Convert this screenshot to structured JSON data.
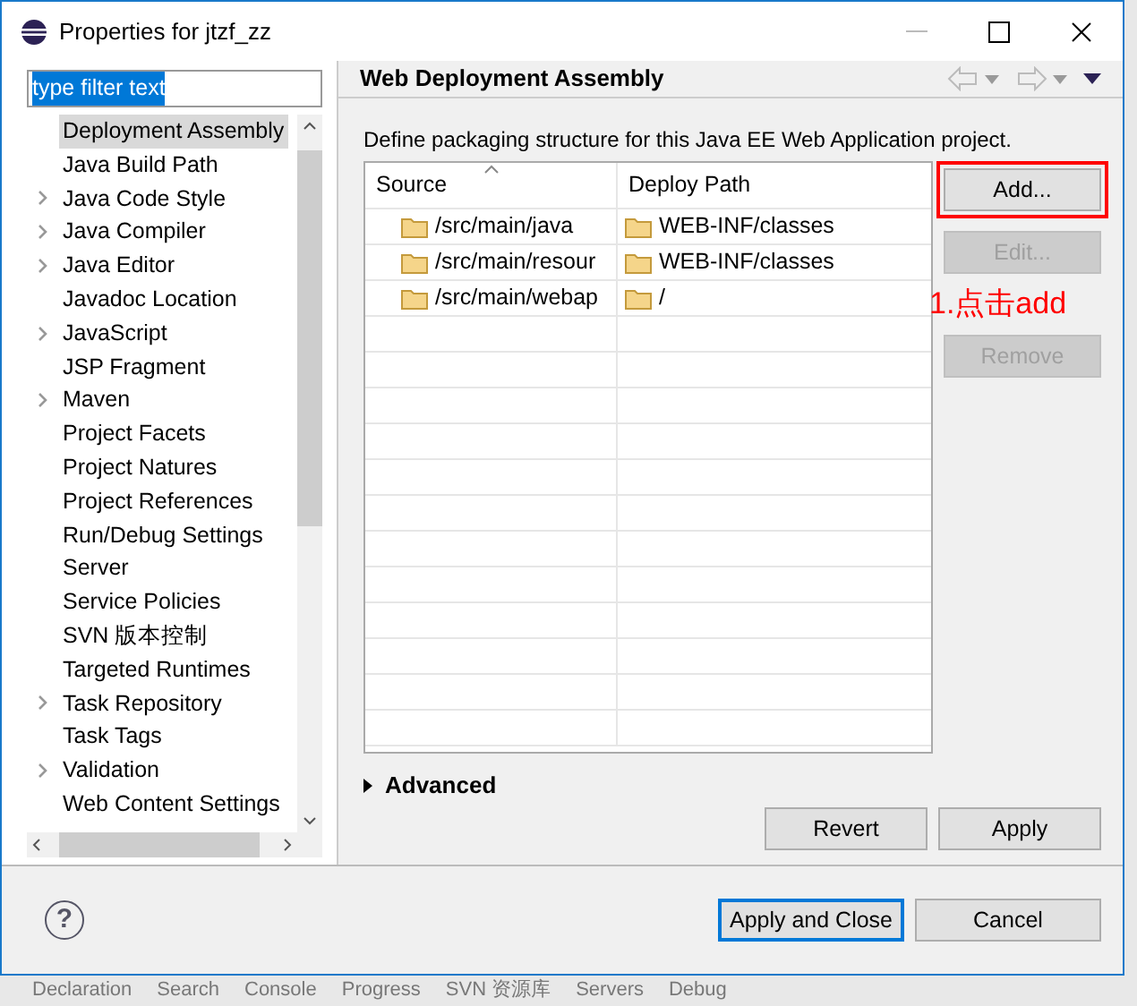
{
  "window": {
    "title": "Properties for jtzf_zz"
  },
  "filter": {
    "value": "type filter text",
    "selected": true
  },
  "tree": {
    "items": [
      {
        "label": "Deployment Assembly",
        "expandable": false,
        "selected": true
      },
      {
        "label": "Java Build Path",
        "expandable": false,
        "selected": false
      },
      {
        "label": "Java Code Style",
        "expandable": true,
        "selected": false
      },
      {
        "label": "Java Compiler",
        "expandable": true,
        "selected": false
      },
      {
        "label": "Java Editor",
        "expandable": true,
        "selected": false
      },
      {
        "label": "Javadoc Location",
        "expandable": false,
        "selected": false
      },
      {
        "label": "JavaScript",
        "expandable": true,
        "selected": false
      },
      {
        "label": "JSP Fragment",
        "expandable": false,
        "selected": false
      },
      {
        "label": "Maven",
        "expandable": true,
        "selected": false
      },
      {
        "label": "Project Facets",
        "expandable": false,
        "selected": false
      },
      {
        "label": "Project Natures",
        "expandable": false,
        "selected": false
      },
      {
        "label": "Project References",
        "expandable": false,
        "selected": false
      },
      {
        "label": "Run/Debug Settings",
        "expandable": false,
        "selected": false
      },
      {
        "label": "Server",
        "expandable": false,
        "selected": false
      },
      {
        "label": "Service Policies",
        "expandable": false,
        "selected": false
      },
      {
        "label": "SVN 版本控制",
        "expandable": false,
        "selected": false
      },
      {
        "label": "Targeted Runtimes",
        "expandable": false,
        "selected": false
      },
      {
        "label": "Task Repository",
        "expandable": true,
        "selected": false
      },
      {
        "label": "Task Tags",
        "expandable": false,
        "selected": false
      },
      {
        "label": "Validation",
        "expandable": true,
        "selected": false
      },
      {
        "label": "Web Content Settings",
        "expandable": false,
        "selected": false
      }
    ]
  },
  "page": {
    "title": "Web Deployment Assembly",
    "description": "Define packaging structure for this Java EE Web Application project.",
    "table": {
      "columns": [
        "Source",
        "Deploy Path"
      ],
      "rows": [
        {
          "source": "/src/main/java",
          "deploy_path": "WEB-INF/classes"
        },
        {
          "source": "/src/main/resour",
          "deploy_path": "WEB-INF/classes"
        },
        {
          "source": "/src/main/webap",
          "deploy_path": "/"
        }
      ]
    },
    "side_buttons": [
      {
        "label": "Add...",
        "disabled": false,
        "highlighted": true
      },
      {
        "label": "Edit...",
        "disabled": true,
        "highlighted": false
      },
      {
        "label": "Remove",
        "disabled": true,
        "highlighted": false
      }
    ],
    "annotation": "1.点击add",
    "advanced": {
      "label": "Advanced",
      "expanded": false
    },
    "buttons": [
      "Revert",
      "Apply"
    ]
  },
  "help": "?",
  "footer_buttons": [
    {
      "label": "Apply and Close",
      "default": true
    },
    {
      "label": "Cancel",
      "default": false
    }
  ],
  "background_tabs": [
    "Declaration",
    "Search",
    "Console",
    "Progress",
    "SVN 资源库",
    "Servers",
    "Debug"
  ]
}
